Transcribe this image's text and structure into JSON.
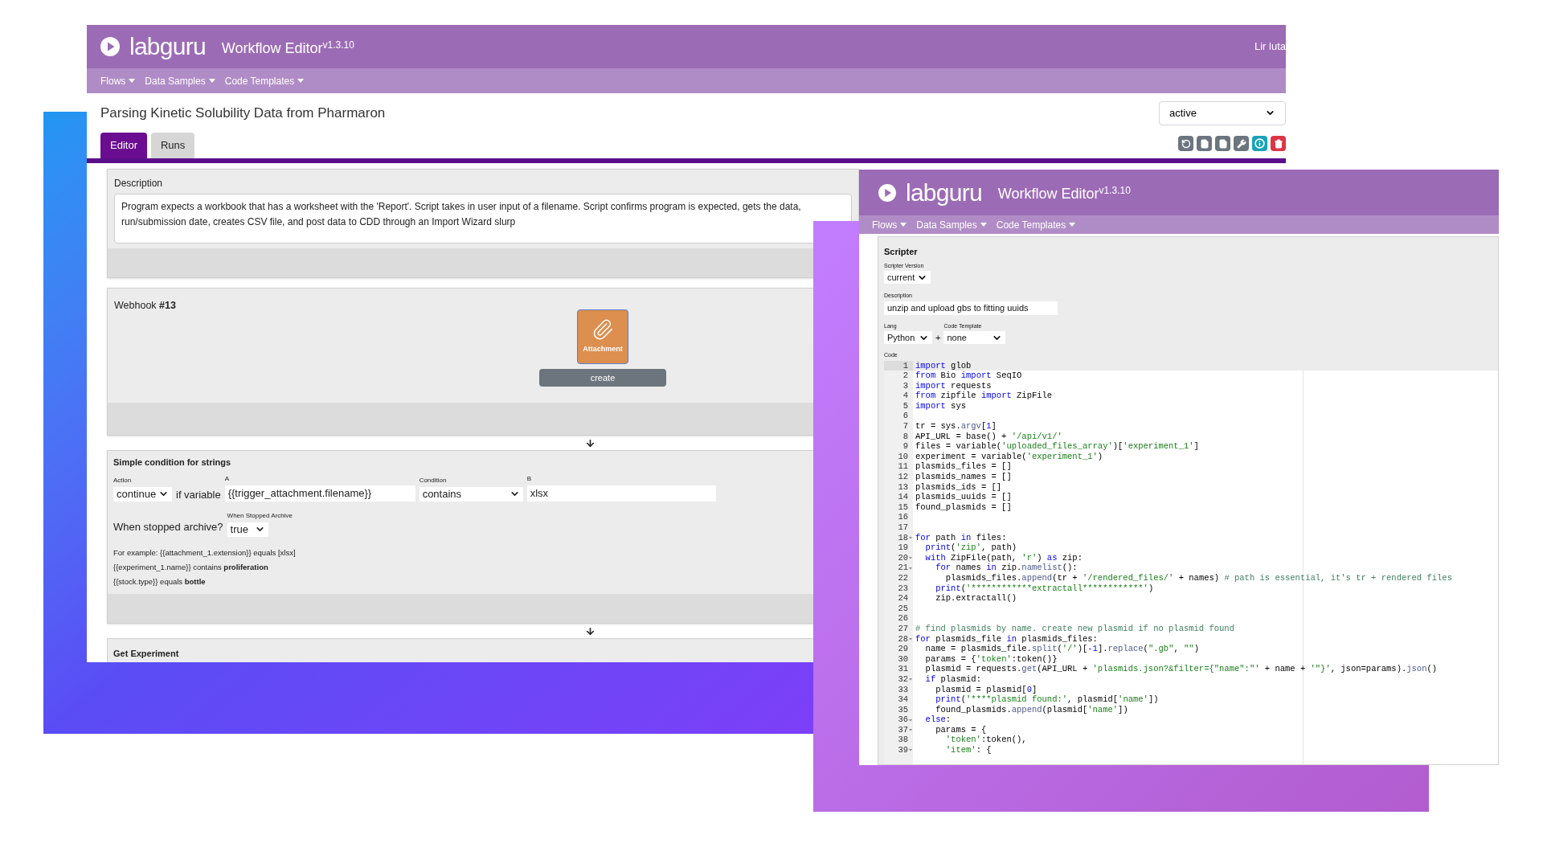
{
  "back_window": {
    "header": {
      "logo": "labguru",
      "title": "Workflow Editor",
      "version": "v1.3.10",
      "user": "Lir luta"
    },
    "nav": [
      "Flows",
      "Data Samples",
      "Code Templates"
    ],
    "flow_title": "Parsing Kinetic Solubility Data from Pharmaron",
    "status": "active",
    "tabs": [
      {
        "label": "Editor",
        "selected": true
      },
      {
        "label": "Runs",
        "selected": false
      }
    ],
    "toolbar": [
      {
        "kind": "undo"
      },
      {
        "kind": "file"
      },
      {
        "kind": "file"
      },
      {
        "kind": "wrench"
      },
      {
        "kind": "info"
      },
      {
        "kind": "delete"
      }
    ],
    "description": {
      "label": "Description",
      "lines": [
        "Program expects a workbook that has a worksheet with the 'Report'. Script takes in user input of a filename. Script confirms program is expected, gets the data,",
        "run/submission date, creates CSV file, and post data to CDD through an Import Wizard slurp"
      ]
    },
    "webhook": {
      "title": "Webhook",
      "number": "#13",
      "tile_label": "Attachment",
      "button": "create"
    },
    "condition": {
      "title": "Simple condition for strings",
      "action_label": "Action",
      "action": "continue",
      "connector": "if variable",
      "a_label": "A",
      "a_value": "{{trigger_attachment.filename}}",
      "condition_label": "Condition",
      "condition": "contains",
      "b_label": "B",
      "b_value": "xlsx",
      "archive_question": "When stopped archive?",
      "archive_label": "When Stopped Archive",
      "archive_value": "true",
      "examples": [
        "For example: {{attachment_1.extension}} equals [xlsx]",
        "{{experiment_1.name}} contains **proliferation**",
        "{{stock.type}} equals **bottle**"
      ]
    },
    "next_card_title": "Get Experiment"
  },
  "front_window": {
    "header": {
      "logo": "labguru",
      "title": "Workflow Editor",
      "version": "v1.3.10"
    },
    "nav": [
      "Flows",
      "Data Samples",
      "Code Templates"
    ],
    "scripter": {
      "title": "Scripter",
      "version_label": "Scripter Version",
      "version": "current",
      "description_label": "Description",
      "description": "unzip and upload gbs to fitting uuids",
      "lang_label": "Lang",
      "lang": "Python",
      "plus": "+",
      "template_label": "Code Template",
      "template": "none",
      "code_label": "Code",
      "lines": [
        {
          "n": "1",
          "fold": false,
          "active": true,
          "tokens": [
            {
              "kind": "kw",
              "text": "import"
            },
            {
              "kind": "p",
              "text": " glob"
            }
          ]
        },
        {
          "n": "2",
          "fold": false,
          "active": false,
          "tokens": [
            {
              "kind": "kw",
              "text": "from"
            },
            {
              "kind": "p",
              "text": " Bio "
            },
            {
              "kind": "kw",
              "text": "import"
            },
            {
              "kind": "p",
              "text": " SeqIO"
            }
          ]
        },
        {
          "n": "3",
          "fold": false,
          "active": false,
          "tokens": [
            {
              "kind": "kw",
              "text": "import"
            },
            {
              "kind": "p",
              "text": " requests"
            }
          ]
        },
        {
          "n": "4",
          "fold": false,
          "active": false,
          "tokens": [
            {
              "kind": "kw",
              "text": "from"
            },
            {
              "kind": "p",
              "text": " zipfile "
            },
            {
              "kind": "kw",
              "text": "import"
            },
            {
              "kind": "p",
              "text": " ZipFile"
            }
          ]
        },
        {
          "n": "5",
          "fold": false,
          "active": false,
          "tokens": [
            {
              "kind": "kw",
              "text": "import"
            },
            {
              "kind": "p",
              "text": " sys"
            }
          ]
        },
        {
          "n": "6",
          "fold": false,
          "active": false
        },
        {
          "n": "7",
          "fold": false,
          "active": false,
          "tokens": [
            {
              "kind": "p",
              "text": "tr = sys."
            },
            {
              "kind": "fn",
              "text": "argv"
            },
            {
              "kind": "p",
              "text": "["
            },
            {
              "kind": "num",
              "text": "1"
            },
            {
              "kind": "p",
              "text": "]"
            }
          ]
        },
        {
          "n": "8",
          "fold": false,
          "active": false,
          "tokens": [
            {
              "kind": "p",
              "text": "API_URL = base() + "
            },
            {
              "kind": "str",
              "text": "'/api/v1/'"
            }
          ]
        },
        {
          "n": "9",
          "fold": false,
          "active": false,
          "tokens": [
            {
              "kind": "p",
              "text": "files = variable("
            },
            {
              "kind": "str",
              "text": "'uploaded_files_array'"
            },
            {
              "kind": "p",
              "text": ")["
            },
            {
              "kind": "str",
              "text": "'experiment_1'"
            },
            {
              "kind": "p",
              "text": "]"
            }
          ]
        },
        {
          "n": "10",
          "fold": false,
          "active": false,
          "tokens": [
            {
              "kind": "p",
              "text": "experiment = variable("
            },
            {
              "kind": "str",
              "text": "'experiment_1'"
            },
            {
              "kind": "p",
              "text": ")"
            }
          ]
        },
        {
          "n": "11",
          "fold": false,
          "active": false,
          "tokens": [
            {
              "kind": "p",
              "text": "plasmids_files = []"
            }
          ]
        },
        {
          "n": "12",
          "fold": false,
          "active": false,
          "tokens": [
            {
              "kind": "p",
              "text": "plasmids_names = []"
            }
          ]
        },
        {
          "n": "13",
          "fold": false,
          "active": false,
          "tokens": [
            {
              "kind": "p",
              "text": "plasmids_ids = []"
            }
          ]
        },
        {
          "n": "14",
          "fold": false,
          "active": false,
          "tokens": [
            {
              "kind": "p",
              "text": "plasmids_uuids = []"
            }
          ]
        },
        {
          "n": "15",
          "fold": false,
          "active": false,
          "tokens": [
            {
              "kind": "p",
              "text": "found_plasmids = []"
            }
          ]
        },
        {
          "n": "16",
          "fold": false,
          "active": false
        },
        {
          "n": "17",
          "fold": false,
          "active": false
        },
        {
          "n": "18",
          "fold": true,
          "active": false,
          "tokens": [
            {
              "kind": "kw",
              "text": "for"
            },
            {
              "kind": "p",
              "text": " path "
            },
            {
              "kind": "kw",
              "text": "in"
            },
            {
              "kind": "p",
              "text": " files:"
            }
          ]
        },
        {
          "n": "19",
          "fold": false,
          "active": false,
          "tokens": [
            {
              "kind": "kw",
              "text": "  print"
            },
            {
              "kind": "p",
              "text": "("
            },
            {
              "kind": "str",
              "text": "'zip'"
            },
            {
              "kind": "p",
              "text": ", path)"
            }
          ]
        },
        {
          "n": "20",
          "fold": true,
          "active": false,
          "tokens": [
            {
              "kind": "kw",
              "text": "  with"
            },
            {
              "kind": "p",
              "text": " ZipFile(path, "
            },
            {
              "kind": "str",
              "text": "'r'"
            },
            {
              "kind": "p",
              "text": ") "
            },
            {
              "kind": "kw",
              "text": "as"
            },
            {
              "kind": "p",
              "text": " zip:"
            }
          ]
        },
        {
          "n": "21",
          "fold": true,
          "active": false,
          "tokens": [
            {
              "kind": "kw",
              "text": "    for"
            },
            {
              "kind": "p",
              "text": " names "
            },
            {
              "kind": "kw",
              "text": "in"
            },
            {
              "kind": "p",
              "text": " zip."
            },
            {
              "kind": "fn",
              "text": "namelist"
            },
            {
              "kind": "p",
              "text": "():"
            }
          ]
        },
        {
          "n": "22",
          "fold": false,
          "active": false,
          "tokens": [
            {
              "kind": "p",
              "text": "      plasmids_files."
            },
            {
              "kind": "fn",
              "text": "append"
            },
            {
              "kind": "p",
              "text": "(tr + "
            },
            {
              "kind": "str",
              "text": "'/rendered_files/'"
            },
            {
              "kind": "p",
              "text": " + names) "
            },
            {
              "kind": "com",
              "text": "# path is essential, it's tr + rendered files"
            }
          ]
        },
        {
          "n": "23",
          "fold": false,
          "active": false,
          "tokens": [
            {
              "kind": "kw",
              "text": "    print"
            },
            {
              "kind": "p",
              "text": "("
            },
            {
              "kind": "str",
              "text": "'************extractall************'"
            },
            {
              "kind": "p",
              "text": ")"
            }
          ]
        },
        {
          "n": "24",
          "fold": false,
          "active": false,
          "tokens": [
            {
              "kind": "p",
              "text": "    zip.extractall()"
            }
          ]
        },
        {
          "n": "25",
          "fold": false,
          "active": false
        },
        {
          "n": "26",
          "fold": false,
          "active": false
        },
        {
          "n": "27",
          "fold": false,
          "active": false,
          "tokens": [
            {
              "kind": "com",
              "text": "# find plasmids by name. create new plasmid if no plasmid found"
            }
          ]
        },
        {
          "n": "28",
          "fold": true,
          "active": false,
          "tokens": [
            {
              "kind": "kw",
              "text": "for"
            },
            {
              "kind": "p",
              "text": " plasmids_file "
            },
            {
              "kind": "kw",
              "text": "in"
            },
            {
              "kind": "p",
              "text": " plasmids_files:"
            }
          ]
        },
        {
          "n": "29",
          "fold": false,
          "active": false,
          "tokens": [
            {
              "kind": "p",
              "text": "  name = plasmids_file."
            },
            {
              "kind": "fn",
              "text": "split"
            },
            {
              "kind": "p",
              "text": "("
            },
            {
              "kind": "str",
              "text": "'/'"
            },
            {
              "kind": "p",
              "text": ")["
            },
            {
              "kind": "num",
              "text": "-1"
            },
            {
              "kind": "p",
              "text": "]."
            },
            {
              "kind": "fn",
              "text": "replace"
            },
            {
              "kind": "p",
              "text": "("
            },
            {
              "kind": "str",
              "text": "\".gb\""
            },
            {
              "kind": "p",
              "text": ", "
            },
            {
              "kind": "str",
              "text": "\"\""
            },
            {
              "kind": "p",
              "text": ")"
            }
          ]
        },
        {
          "n": "30",
          "fold": false,
          "active": false,
          "tokens": [
            {
              "kind": "p",
              "text": "  params = {"
            },
            {
              "kind": "str",
              "text": "'token'"
            },
            {
              "kind": "p",
              "text": ":token()}"
            }
          ]
        },
        {
          "n": "31",
          "fold": false,
          "active": false,
          "tokens": [
            {
              "kind": "p",
              "text": "  plasmid = requests."
            },
            {
              "kind": "fn",
              "text": "get"
            },
            {
              "kind": "p",
              "text": "(API_URL + "
            },
            {
              "kind": "str",
              "text": "'plasmids.json?&filter={\"name\":\"'"
            },
            {
              "kind": "p",
              "text": " + name + "
            },
            {
              "kind": "str",
              "text": "'\"}'"
            },
            {
              "kind": "p",
              "text": ", json=params)."
            },
            {
              "kind": "fn",
              "text": "json"
            },
            {
              "kind": "p",
              "text": "()"
            }
          ]
        },
        {
          "n": "32",
          "fold": true,
          "active": false,
          "tokens": [
            {
              "kind": "kw",
              "text": "  if"
            },
            {
              "kind": "p",
              "text": " plasmid:"
            }
          ]
        },
        {
          "n": "33",
          "fold": false,
          "active": false,
          "tokens": [
            {
              "kind": "p",
              "text": "    plasmid = plasmid["
            },
            {
              "kind": "num",
              "text": "0"
            },
            {
              "kind": "p",
              "text": "]"
            }
          ]
        },
        {
          "n": "34",
          "fold": false,
          "active": false,
          "tokens": [
            {
              "kind": "kw",
              "text": "    print"
            },
            {
              "kind": "p",
              "text": "("
            },
            {
              "kind": "str",
              "text": "'****plasmid found:'"
            },
            {
              "kind": "p",
              "text": ", plasmid["
            },
            {
              "kind": "str",
              "text": "'name'"
            },
            {
              "kind": "p",
              "text": "])"
            }
          ]
        },
        {
          "n": "35",
          "fold": false,
          "active": false,
          "tokens": [
            {
              "kind": "p",
              "text": "    found_plasmids."
            },
            {
              "kind": "fn",
              "text": "append"
            },
            {
              "kind": "p",
              "text": "(plasmid["
            },
            {
              "kind": "str",
              "text": "'name'"
            },
            {
              "kind": "p",
              "text": "])"
            }
          ]
        },
        {
          "n": "36",
          "fold": true,
          "active": false,
          "tokens": [
            {
              "kind": "kw",
              "text": "  else"
            },
            {
              "kind": "p",
              "text": ":"
            }
          ]
        },
        {
          "n": "37",
          "fold": true,
          "active": false,
          "tokens": [
            {
              "kind": "p",
              "text": "    params = {"
            }
          ]
        },
        {
          "n": "38",
          "fold": false,
          "active": false,
          "tokens": [
            {
              "kind": "str",
              "text": "      'token'"
            },
            {
              "kind": "p",
              "text": ":token(),"
            }
          ]
        },
        {
          "n": "39",
          "fold": true,
          "active": false,
          "tokens": [
            {
              "kind": "str",
              "text": "      'item'"
            },
            {
              "kind": "p",
              "text": ": {"
            }
          ]
        }
      ]
    }
  }
}
